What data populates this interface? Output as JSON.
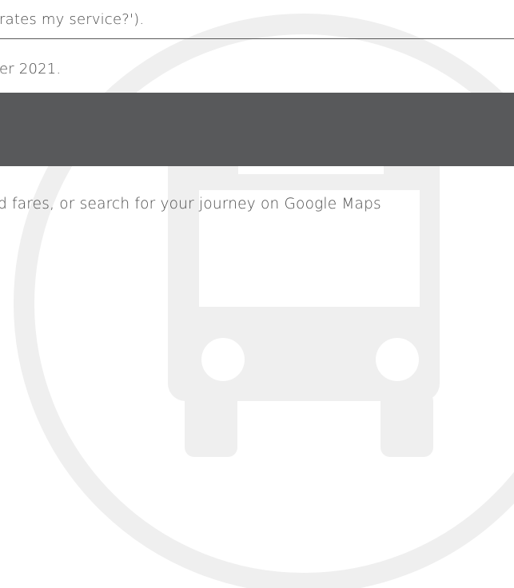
{
  "content": {
    "line_1": "rates my service?').",
    "line_2": "er 2021.",
    "line_3": "d fares, or search for your journey on Google Maps"
  },
  "watermark": {
    "icon": "bus-icon",
    "color": "#efefef"
  },
  "banner": {
    "color": "#58595b"
  }
}
